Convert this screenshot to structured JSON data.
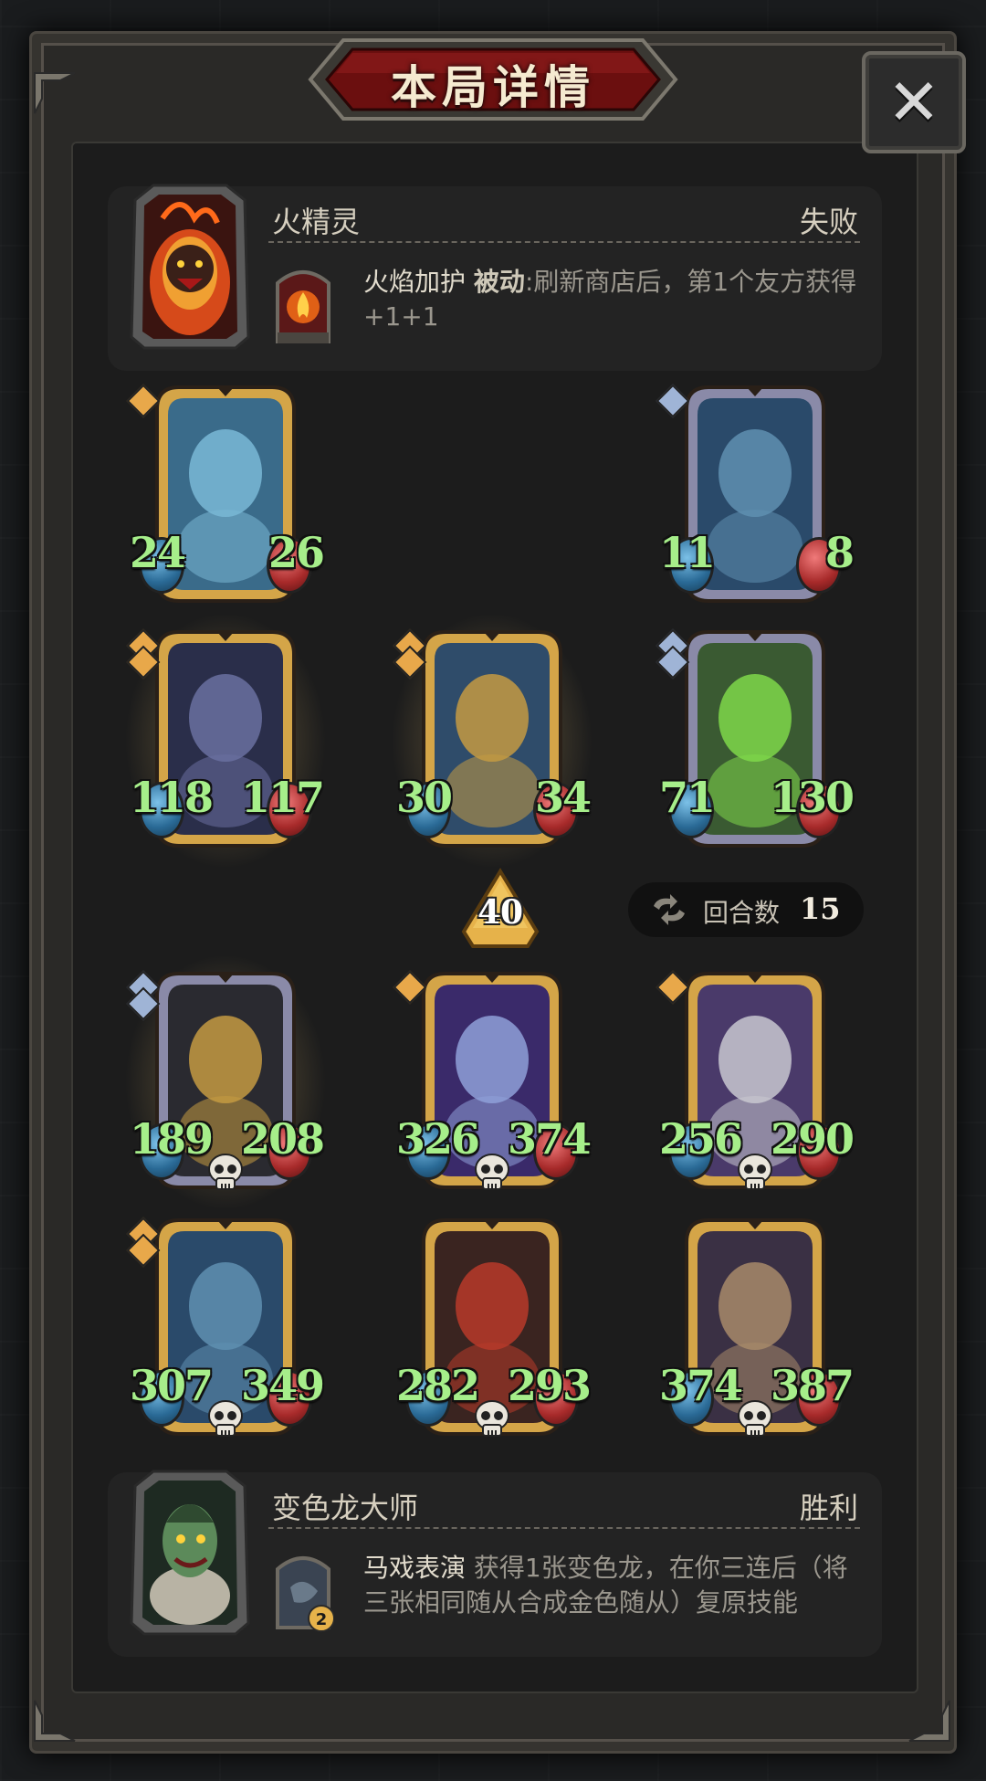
{
  "header": {
    "title": "本局详情",
    "close_glyph": "✕"
  },
  "opponent": {
    "name": "火精灵",
    "result": "失败",
    "portrait_icon": "fire-elemental-portrait",
    "skill": {
      "icon": "fire-shield-icon",
      "name": "火焰加护",
      "type": "被动",
      "description": ":刷新商店后，第1个友方获得+1+1"
    }
  },
  "opponent_board": [
    {
      "name": "dragon",
      "atk": "24",
      "hp": "26",
      "frame": "gold",
      "tier_gems": 1,
      "dead": false
    },
    {
      "name": "elf-sorceress",
      "atk": "11",
      "hp": "8",
      "frame": "silver",
      "tier_gems": 1,
      "dead": false
    },
    {
      "name": "hooded-rogue",
      "atk": "118",
      "hp": "117",
      "frame": "gold",
      "tier_gems": 2,
      "dead": false,
      "golden": true
    },
    {
      "name": "armored-knight",
      "atk": "30",
      "hp": "34",
      "frame": "gold",
      "tier_gems": 2,
      "dead": false,
      "golden": true
    },
    {
      "name": "poison-beast",
      "atk": "71",
      "hp": "130",
      "frame": "silver",
      "tier_gems": 2,
      "dead": false
    }
  ],
  "level_badge": {
    "value": "40"
  },
  "turns": {
    "label": "回合数",
    "value": "15",
    "icon": "swap-arrows-icon"
  },
  "player_board": [
    {
      "name": "anubis-warrior",
      "atk": "189",
      "hp": "208",
      "frame": "silver",
      "tier_gems": 2,
      "dead": true,
      "golden": true
    },
    {
      "name": "star-wizard",
      "atk": "326",
      "hp": "374",
      "frame": "gold",
      "tier_gems": 1,
      "dead": true
    },
    {
      "name": "paladin",
      "atk": "256",
      "hp": "290",
      "frame": "gold",
      "tier_gems": 1,
      "dead": true
    },
    {
      "name": "elf-sorceress",
      "atk": "307",
      "hp": "349",
      "frame": "gold",
      "tier_gems": 2,
      "dead": true
    },
    {
      "name": "red-dragon",
      "atk": "282",
      "hp": "293",
      "frame": "gold",
      "tier_gems": 0,
      "dead": true
    },
    {
      "name": "brute",
      "atk": "374",
      "hp": "387",
      "frame": "gold",
      "tier_gems": 0,
      "dead": true
    }
  ],
  "player": {
    "name": "变色龙大师",
    "result": "胜利",
    "portrait_icon": "chameleon-portrait",
    "skill": {
      "icon": "circus-card-icon",
      "badge": "2",
      "name": "马戏表演",
      "description": "获得1张变色龙，在你三连后（将三张相同随从合成金色随从）复原技能"
    }
  },
  "colors": {
    "stat_green": "#a6ee8a",
    "gold_frame": "#d4a548",
    "silver_frame": "#8a8aa8",
    "banner_red": "#7a1212"
  }
}
